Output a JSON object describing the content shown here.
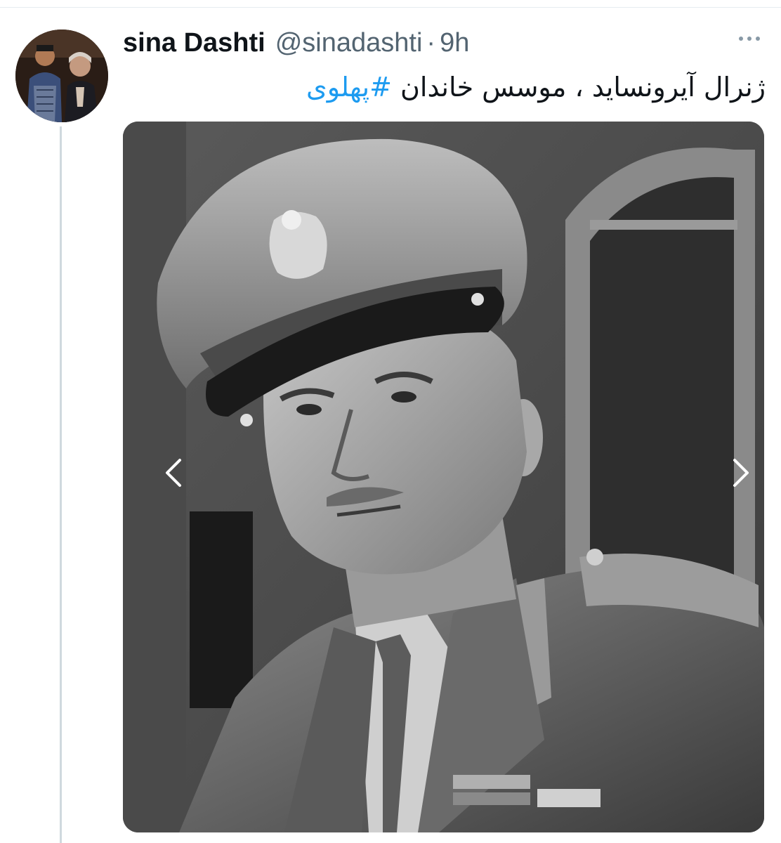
{
  "tweet": {
    "author_name": "sina Dashti",
    "handle": "@sinadashti",
    "separator": "·",
    "time": "9h",
    "text": "ژنرال آیرونساید ، موسس خاندان ",
    "hashtag": "#پهلوی"
  },
  "media": {
    "subject": "black-and-white portrait of a military officer in peaked cap",
    "prev_icon": "chevron-left-icon",
    "next_icon": "chevron-right-icon"
  },
  "icons": {
    "more": "more-horizontal-icon"
  },
  "colors": {
    "text": "#0f1419",
    "secondary": "#536471",
    "link": "#1d9bf0",
    "thread_line": "#cfd9de"
  }
}
